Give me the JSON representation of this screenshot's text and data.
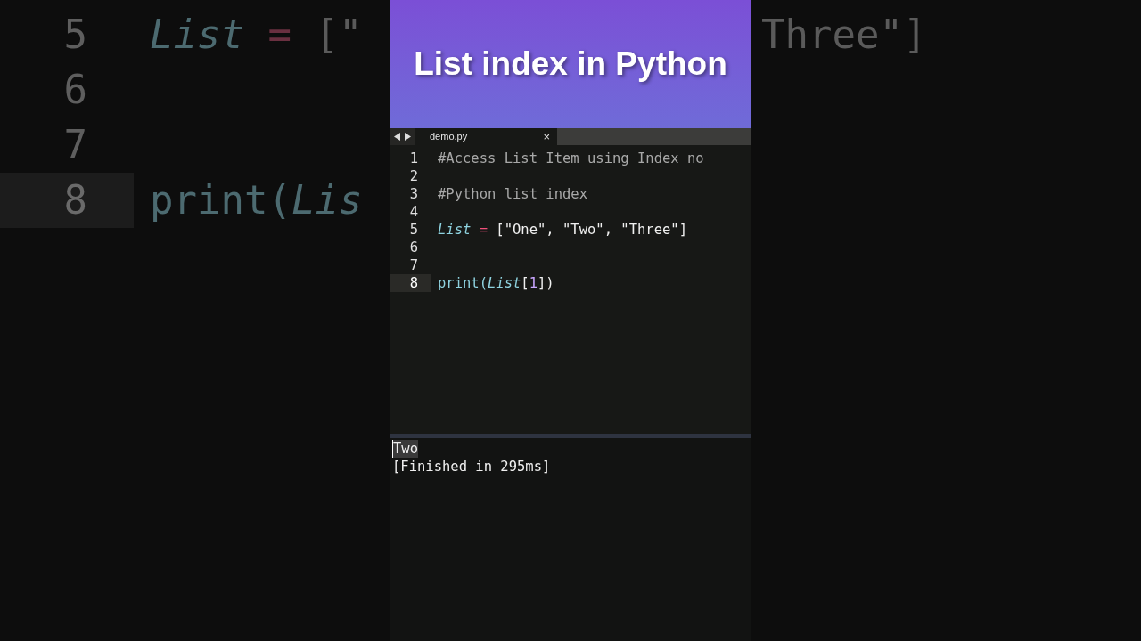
{
  "backdrop_left": {
    "lines": [
      {
        "number": "5",
        "code": [
          {
            "kind": "var",
            "text": "List"
          },
          {
            "kind": "op",
            "text": " = "
          },
          {
            "kind": "punct",
            "text": "[\""
          }
        ],
        "current": false
      },
      {
        "number": "6",
        "current": false
      },
      {
        "number": "7",
        "current": false
      },
      {
        "number": "8",
        "code": [
          {
            "kind": "func",
            "text": "print("
          },
          {
            "kind": "var",
            "text": "Lis"
          }
        ],
        "current": true
      }
    ]
  },
  "backdrop_right": {
    "text": "Three\"]"
  },
  "title": "List index in Python",
  "tab": {
    "label": "demo.py",
    "close": "×"
  },
  "editor": {
    "lines": [
      {
        "number": "1",
        "current": false,
        "code": [
          {
            "kind": "comment",
            "text": "#Access List Item using Index no"
          }
        ]
      },
      {
        "number": "2",
        "current": false
      },
      {
        "number": "3",
        "current": false,
        "code": [
          {
            "kind": "comment",
            "text": "#Python list index"
          }
        ]
      },
      {
        "number": "4",
        "current": false
      },
      {
        "number": "5",
        "current": false,
        "code": [
          {
            "kind": "var",
            "text": "List"
          },
          {
            "kind": "op",
            "text": " = "
          },
          {
            "kind": "punct",
            "text": "[\"One\", \"Two\", \"Three\"]"
          }
        ]
      },
      {
        "number": "6",
        "current": false
      },
      {
        "number": "7",
        "current": false
      },
      {
        "number": "8",
        "current": true,
        "code": [
          {
            "kind": "func",
            "text": "print("
          },
          {
            "kind": "var",
            "text": "List"
          },
          {
            "kind": "punct",
            "text": "["
          },
          {
            "kind": "number",
            "text": "1"
          },
          {
            "kind": "punct",
            "text": "])"
          }
        ]
      }
    ]
  },
  "output": {
    "lines": [
      {
        "text": "Two",
        "highlighted": true
      },
      {
        "text": "[Finished in 295ms]",
        "highlighted": false
      }
    ]
  }
}
